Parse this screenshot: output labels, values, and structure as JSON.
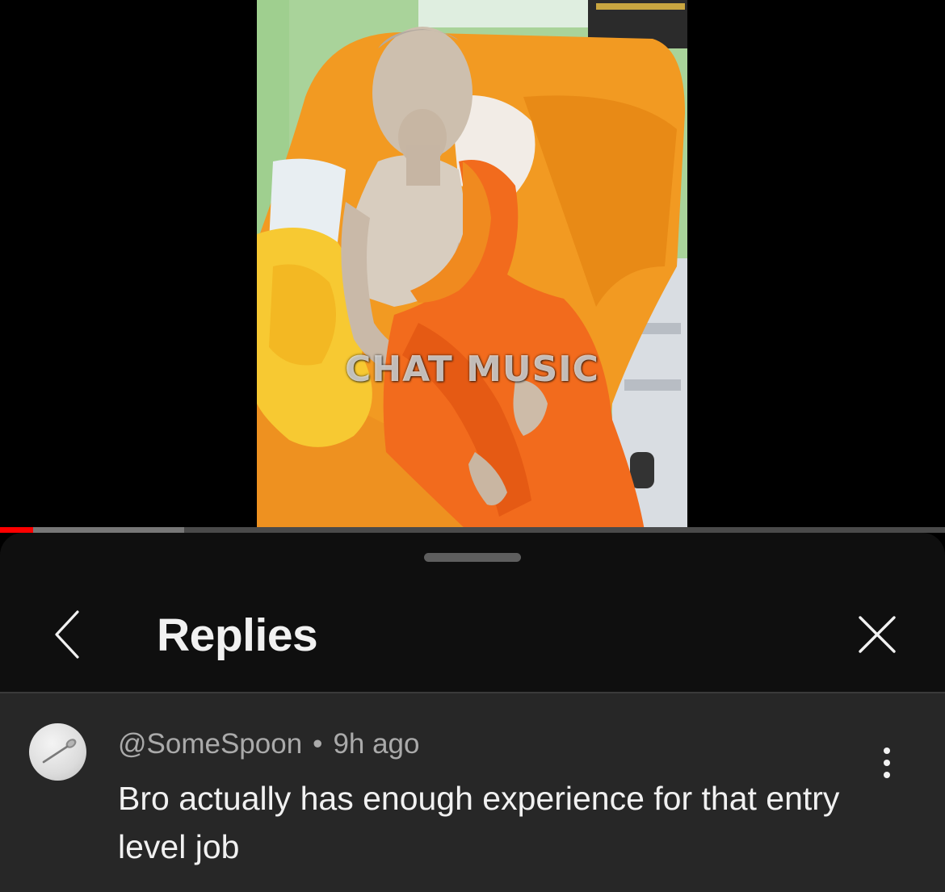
{
  "video": {
    "watermark": "CHAT MUSIC",
    "progress": {
      "played_fraction": 0.035,
      "buffered_fraction": 0.195
    },
    "colors": {
      "played": "#ff0000",
      "buffered": "#777777",
      "track": "#4a4a4a"
    }
  },
  "sheet": {
    "title": "Replies",
    "back_icon": "chevron-left-icon",
    "close_icon": "close-icon"
  },
  "comment": {
    "author": "@SomeSpoon",
    "separator": "•",
    "time": "9h ago",
    "text": "Bro actually has enough experience for that entry level job",
    "avatar_icon": "spoon-icon",
    "menu_icon": "more-vertical-icon"
  }
}
